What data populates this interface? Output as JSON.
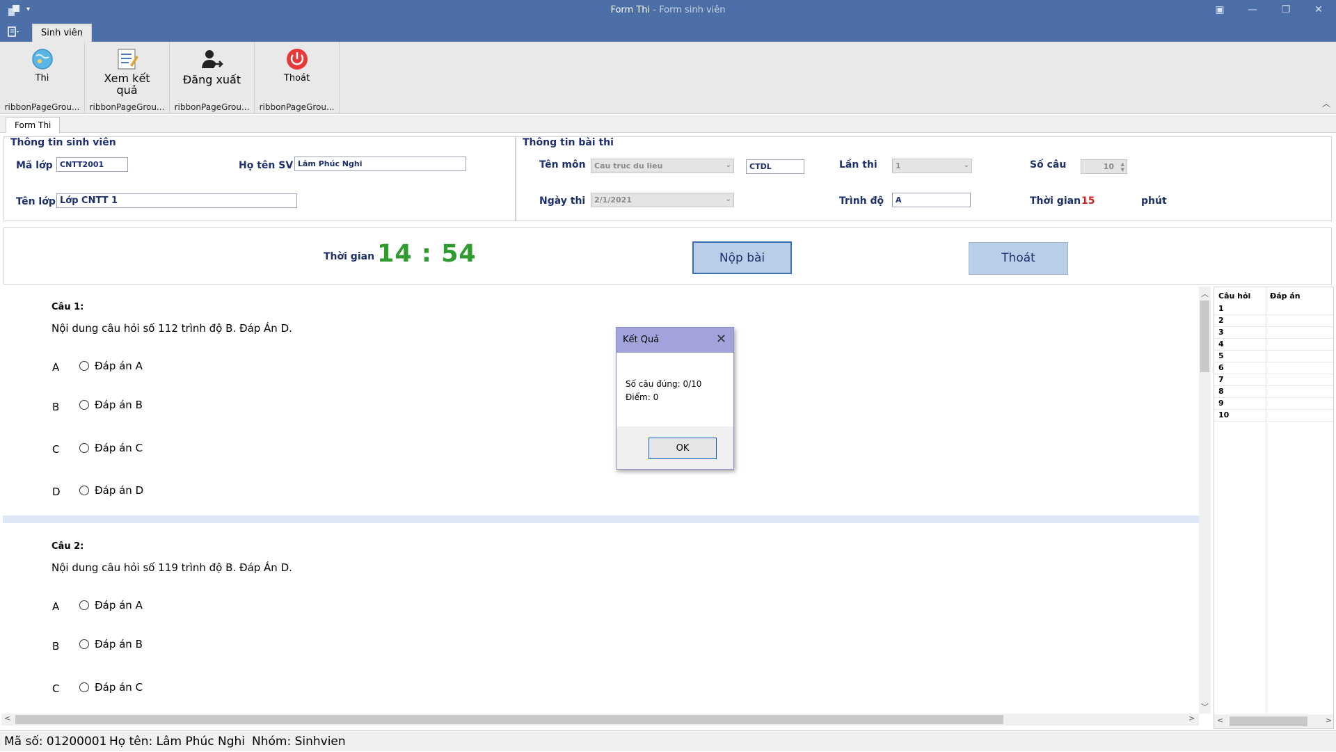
{
  "window": {
    "title": "Form Thi",
    "subtitle": " - Form sinh viên"
  },
  "ribbon": {
    "tab": "Sinh viên",
    "buttons": [
      {
        "label": "Thi",
        "icon": "exam-globe-icon",
        "group": "ribbonPageGrou..."
      },
      {
        "label": "Xem kết quả",
        "icon": "view-results-icon",
        "group": "ribbonPageGrou..."
      },
      {
        "label": "Đăng xuất",
        "icon": "logout-user-icon",
        "group": "ribbonPageGrou..."
      },
      {
        "label": "Thoát",
        "icon": "power-icon",
        "group": "ribbonPageGrou..."
      }
    ]
  },
  "doc_tab": "Form Thi",
  "student_info": {
    "title": "Thông tin sinh viên",
    "class_code_label": "Mã lớp",
    "class_code": "CNTT2001",
    "name_label": "Họ tên SV",
    "name": "Lâm Phúc Nghi",
    "class_name_label": "Tên lớp",
    "class_name": "Lớp CNTT 1"
  },
  "exam_info": {
    "title": "Thông tin bài thi",
    "subject_label": "Tên môn",
    "subject": "Cau truc du lieu",
    "subject_code": "CTDL",
    "attempt_label": "Lần thi",
    "attempt": "1",
    "num_questions_label": "Số câu",
    "num_questions": "10",
    "date_label": "Ngày thi",
    "date": "2/1/2021",
    "level_label": "Trình độ",
    "level": "A",
    "duration_label": "Thời gian",
    "duration": "15",
    "duration_unit": "phút"
  },
  "timer": {
    "label": "Thời gian",
    "value": "14 : 54"
  },
  "actions": {
    "submit": "Nộp bài",
    "exit": "Thoát"
  },
  "questions": [
    {
      "title": "Câu 1:",
      "text": "Nội dung câu hỏi số 112 trình độ B. Đáp Án D.",
      "options": [
        {
          "letter": "A",
          "text": "Đáp án A"
        },
        {
          "letter": "B",
          "text": "Đáp án B"
        },
        {
          "letter": "C",
          "text": "Đáp án C"
        },
        {
          "letter": "D",
          "text": "Đáp án D"
        }
      ]
    },
    {
      "title": "Câu 2:",
      "text": "Nội dung câu hỏi số 119 trình độ B. Đáp Án D.",
      "options": [
        {
          "letter": "A",
          "text": "Đáp án A"
        },
        {
          "letter": "B",
          "text": "Đáp án B"
        },
        {
          "letter": "C",
          "text": "Đáp án C"
        }
      ]
    }
  ],
  "answer_grid": {
    "col_question": "Câu hỏi",
    "col_answer": "Đáp án",
    "rows": [
      "1",
      "2",
      "3",
      "4",
      "5",
      "6",
      "7",
      "8",
      "9",
      "10"
    ]
  },
  "dialog": {
    "title": "Kết Quả",
    "line1": "Số câu đúng: 0/10",
    "line2": "Điểm: 0",
    "ok": "OK"
  },
  "status_bar": {
    "id": "Mã số: 01200001",
    "name": "Họ tên: Lâm Phúc Nghi",
    "group": "Nhóm: Sinhvien"
  },
  "colors": {
    "titlebar": "#4d6fa8",
    "label_navy": "#1c2f6e",
    "timer_green": "#2f9c2f",
    "duration_red": "#d02020",
    "dialog_header": "#a3a3dc"
  }
}
